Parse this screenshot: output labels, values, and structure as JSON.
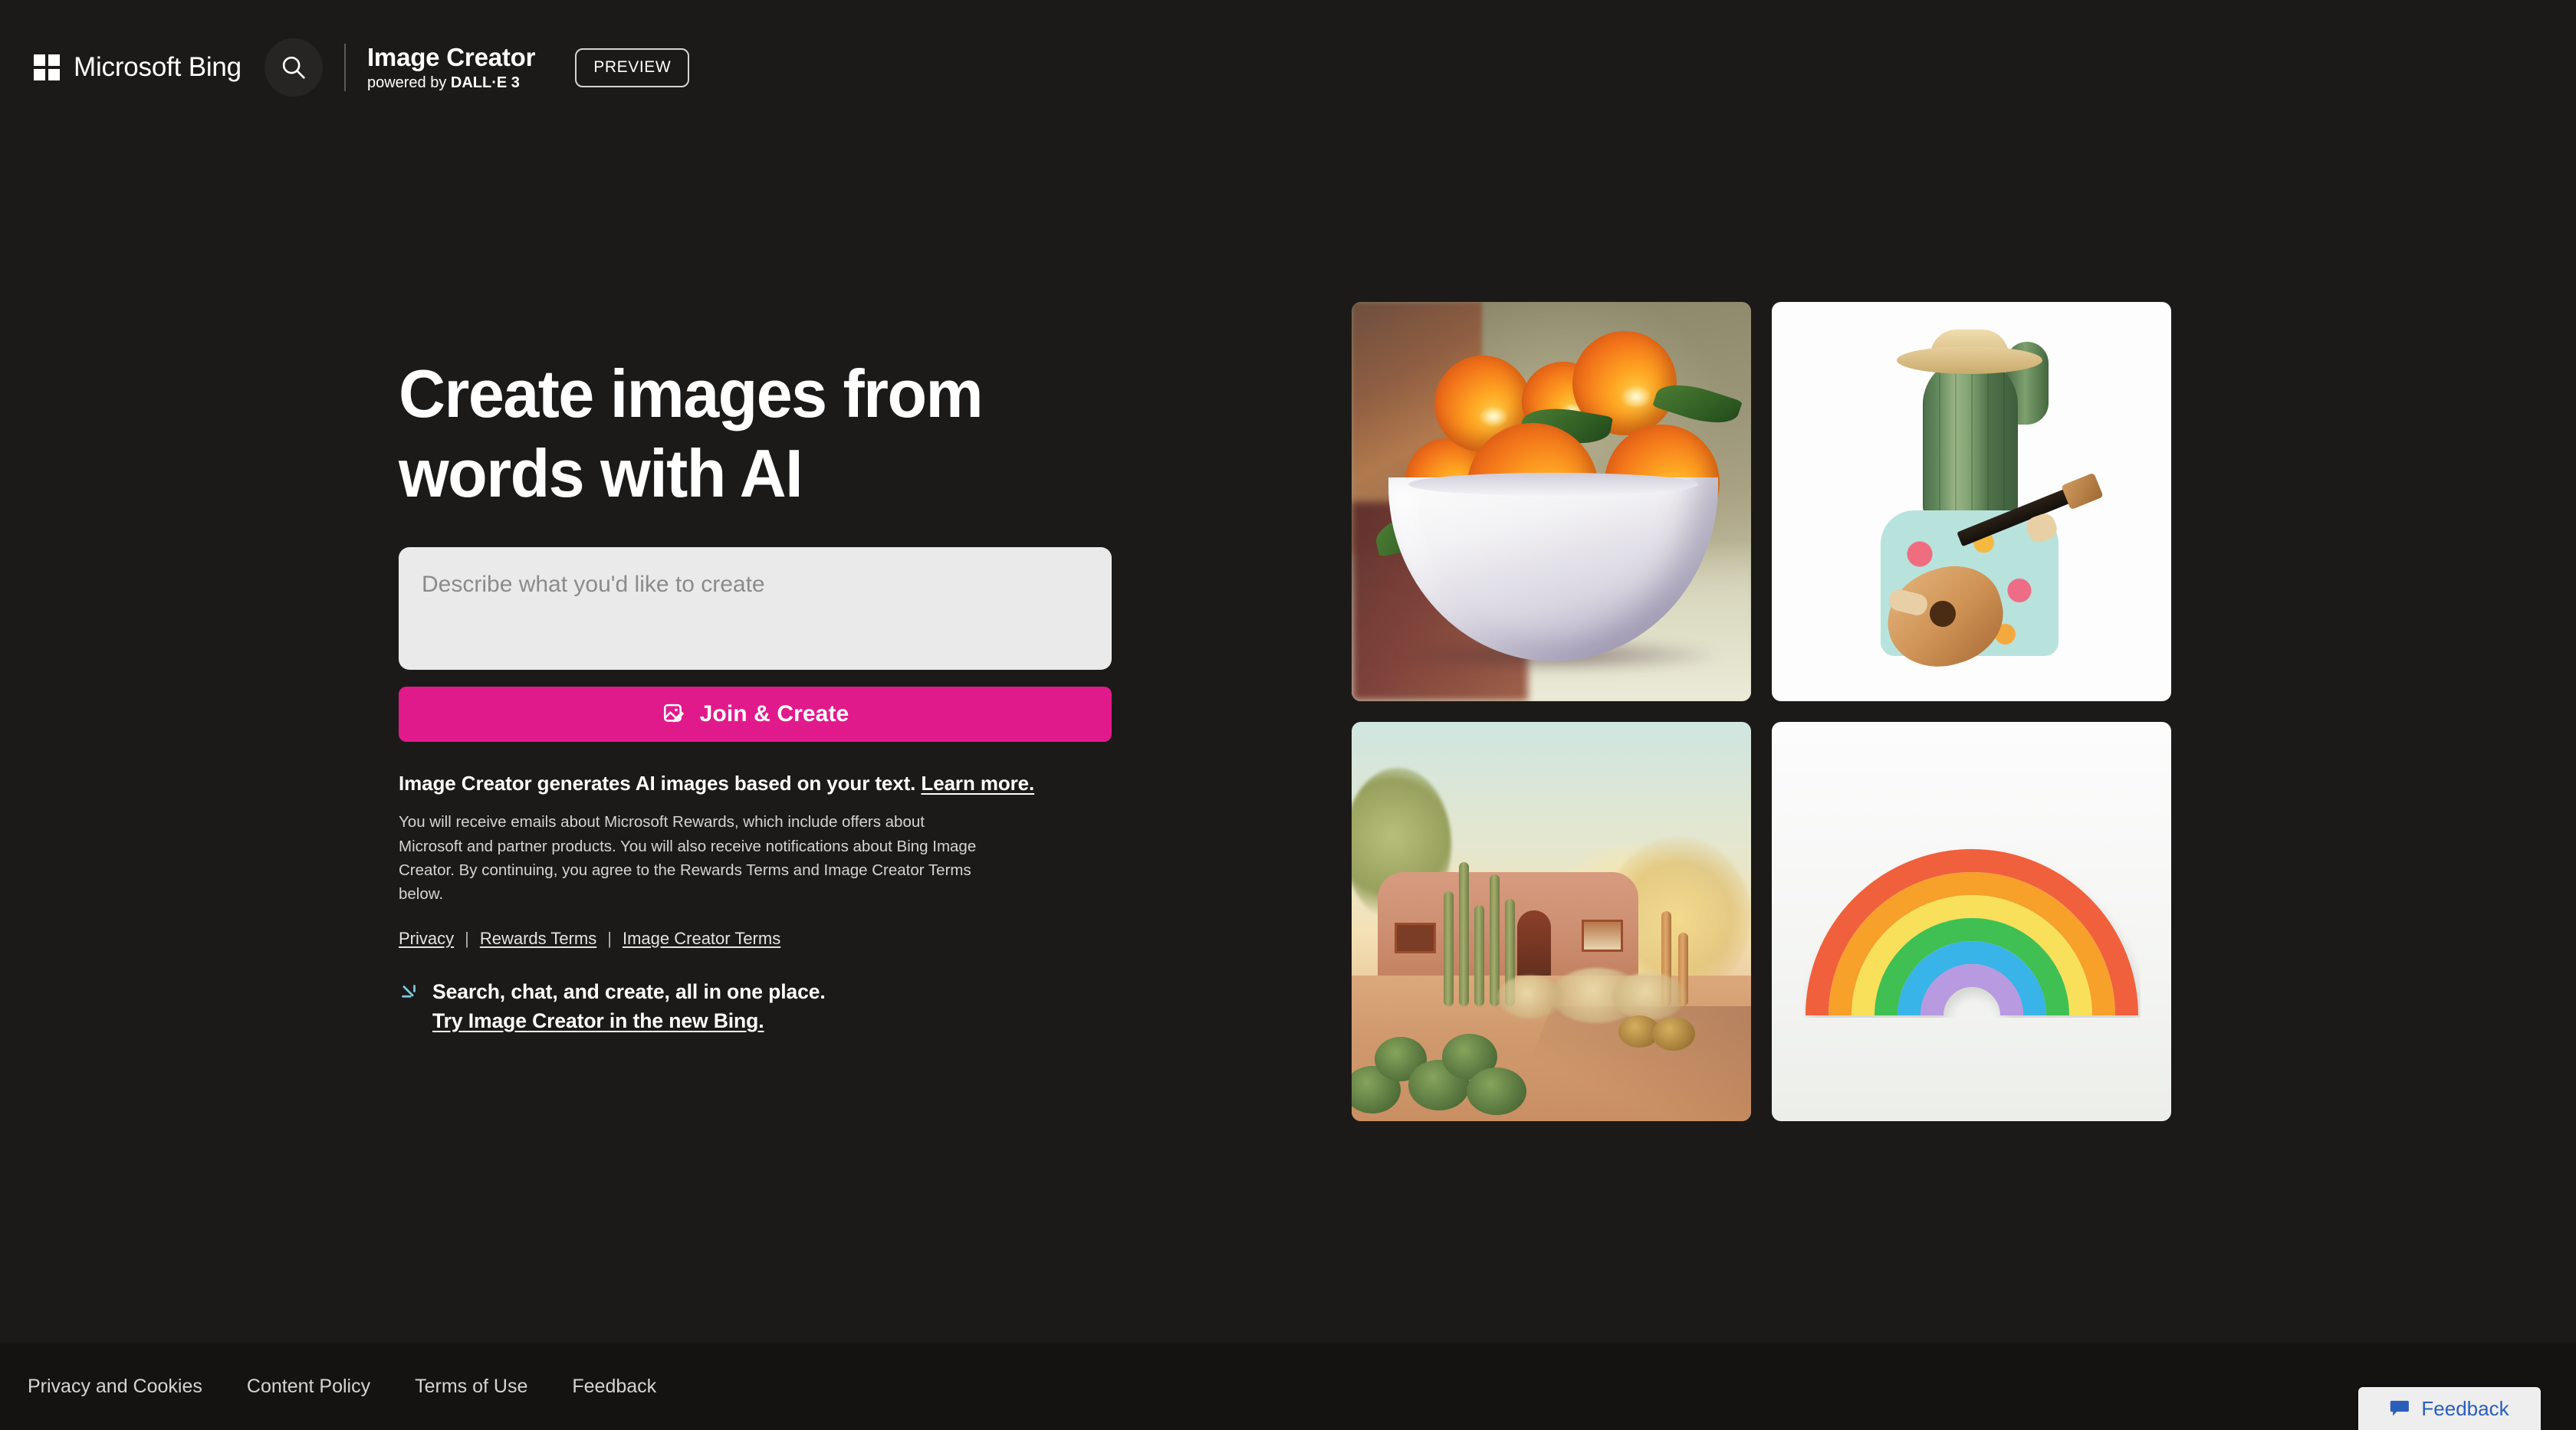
{
  "header": {
    "brand": "Microsoft Bing",
    "search_icon": "search-icon",
    "app_title": "Image Creator",
    "app_sub_prefix": "powered by ",
    "app_sub_bold": "DALL·E 3",
    "preview_badge": "PREVIEW"
  },
  "hero": {
    "headline": "Create images from words with AI",
    "prompt_placeholder": "Describe what you'd like to create",
    "prompt_value": "",
    "cta_label": "Join & Create",
    "cta_icon": "image-edit-icon",
    "cta_color": "#e11a8c"
  },
  "legal": {
    "head_text": "Image Creator generates AI images based on your text. ",
    "head_link": "Learn more.",
    "body": "You will receive emails about Microsoft Rewards, which include offers about Microsoft and partner products. You will also receive notifications about Bing Image Creator. By continuing, you agree to the Rewards Terms and Image Creator Terms below.",
    "links": [
      "Privacy",
      "Rewards Terms",
      "Image Creator Terms"
    ],
    "separator": "|"
  },
  "promo": {
    "icon": "bing-chat-arrow-icon",
    "icon_color": "#7ec9df",
    "line1": "Search, chat, and create, all in one place.",
    "line2": "Try Image Creator in the new Bing."
  },
  "gallery": {
    "tiles": [
      {
        "name": "oranges-oil-painting",
        "alt": "Oil painting of oranges in a white bowl"
      },
      {
        "name": "cactus-guitarist",
        "alt": "Cactus wearing a straw hat and floral shirt playing a guitar"
      },
      {
        "name": "desert-adobe-house",
        "alt": "Adobe house in a desert garden at golden hour"
      },
      {
        "name": "paper-rainbow",
        "alt": "Paper craft rainbow arch on a white background"
      }
    ]
  },
  "footer": {
    "links": [
      "Privacy and Cookies",
      "Content Policy",
      "Terms of Use",
      "Feedback"
    ],
    "feedback_tab": {
      "label": "Feedback",
      "icon": "speech-bubble-icon",
      "color": "#2b5eb8"
    }
  }
}
